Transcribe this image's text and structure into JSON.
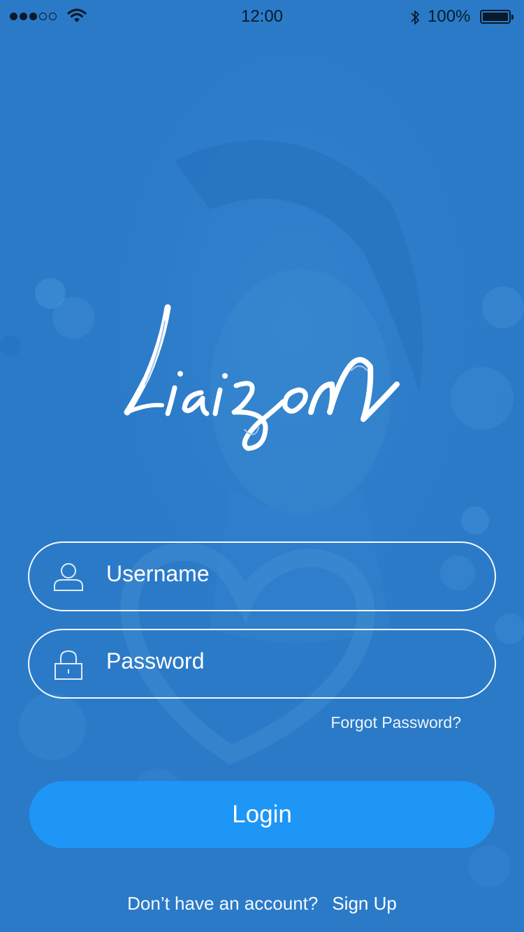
{
  "status_bar": {
    "time": "12:00",
    "battery_percent": "100%",
    "signal_bars_filled": 3,
    "signal_bars_total": 5
  },
  "brand": {
    "logo_text": "Liaison"
  },
  "form": {
    "username": {
      "placeholder": "Username",
      "icon": "user-icon"
    },
    "password": {
      "placeholder": "Password",
      "icon": "lock-icon"
    },
    "forgot_password": "Forgot Password?",
    "login_label": "Login"
  },
  "footer": {
    "prompt": "Don’t have an account?",
    "signup_label": "Sign Up"
  },
  "colors": {
    "background": "#2a7ac8",
    "login_button": "#1e96f5",
    "text": "#ffffff",
    "status_text": "#0b1a2a"
  }
}
